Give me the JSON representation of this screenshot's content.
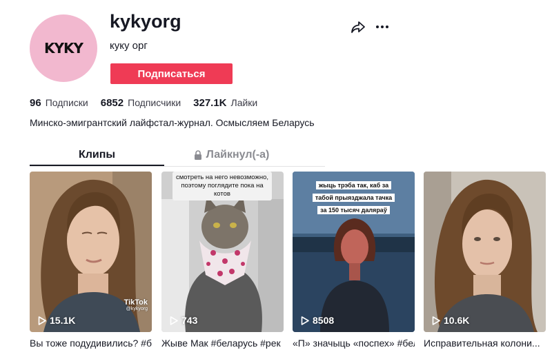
{
  "profile": {
    "avatar_text": "KYKY",
    "username": "kykyorg",
    "nickname": "куку орг",
    "follow_label": "Подписаться",
    "bio": "Минско-эмигрантский лайфстал-журнал. Осмысляем Беларусь"
  },
  "stats": [
    {
      "value": "96",
      "label": "Подписки"
    },
    {
      "value": "6852",
      "label": "Подписчики"
    },
    {
      "value": "327.1K",
      "label": "Лайки"
    }
  ],
  "tabs": {
    "clips": "Клипы",
    "liked": "Лайкнул(-а)"
  },
  "icons": {
    "share": "share-icon",
    "more": "more-icon",
    "lock": "lock-icon",
    "play": "play-icon"
  },
  "colors": {
    "accent": "#ef3b55",
    "avatar_bg": "#f2b8cf"
  },
  "videos": [
    {
      "views": "15.1K",
      "caption": "Вы тоже подудивились? #б",
      "watermark": "TikTok",
      "watermark_user": "@kykyorg"
    },
    {
      "views": "743",
      "caption": "Жыве Мак #беларусь #рек",
      "overlay": "смотреть на него невозможно, поэтому поглядите пока на котов"
    },
    {
      "views": "8508",
      "caption": "«П» значыць «поспех» #бел",
      "overlay_lines": [
        "жыць трэба так, каб за",
        "табой прыязджала тачка",
        "за 150 тысяч даляраў"
      ]
    },
    {
      "views": "10.6K",
      "caption": "Исправительная колони..."
    }
  ]
}
